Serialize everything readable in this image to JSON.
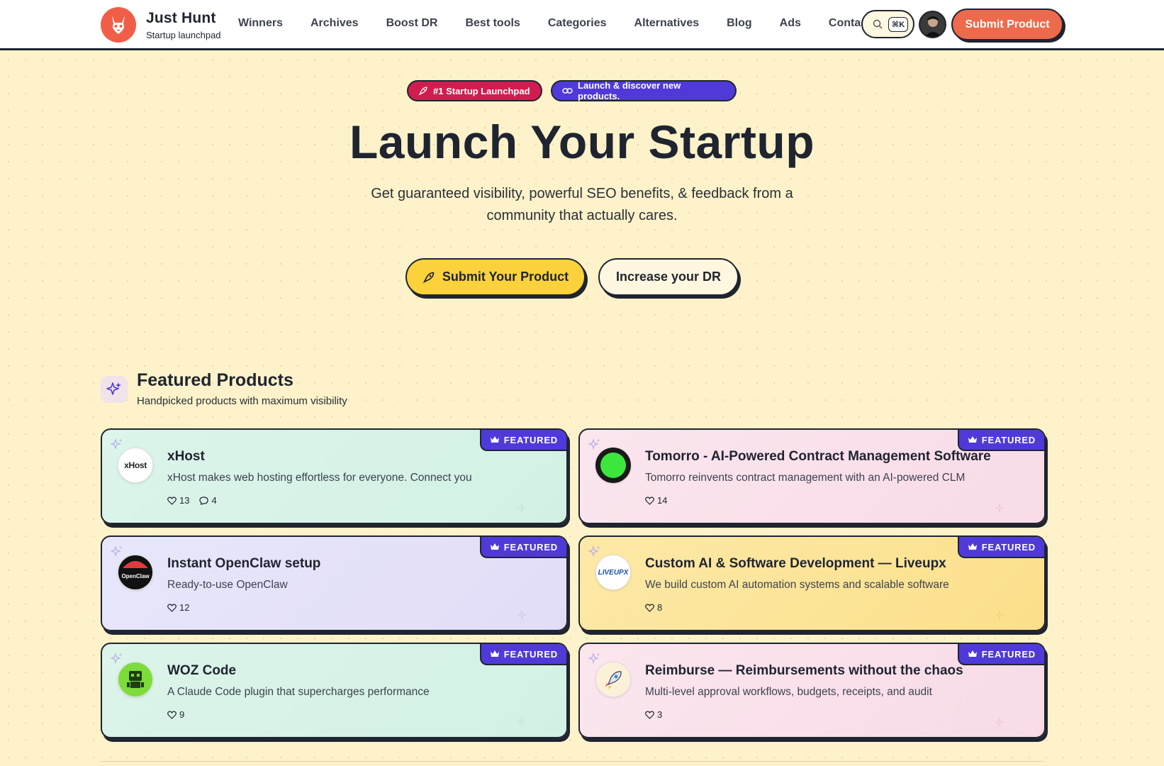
{
  "header": {
    "brand_name": "Just Hunt",
    "brand_sub": "Startup launchpad",
    "nav": [
      "Winners",
      "Archives",
      "Boost DR",
      "Best tools",
      "Categories",
      "Alternatives",
      "Blog",
      "Ads",
      "Contact"
    ],
    "search_kbd": "⌘K",
    "submit_label": "Submit  Product"
  },
  "hero": {
    "badge_1": "#1 Startup Launchpad",
    "badge_2": "Launch & discover new products.",
    "title": "Launch Your Startup",
    "subtitle_line_1": "Get guaranteed visibility, powerful SEO benefits, & feedback from a",
    "subtitle_line_2": "community that actually cares.",
    "primary_cta": "Submit Your Product",
    "secondary_cta": "Increase your DR"
  },
  "featured": {
    "title": "Featured Products",
    "subtitle": "Handpicked products with maximum visibility",
    "tag_label": "FEATURED",
    "products": [
      {
        "name": "xHost",
        "desc": "xHost makes web hosting effortless for everyone. Connect you",
        "likes": "13",
        "comments": "4",
        "logo_text": "xHost"
      },
      {
        "name": "Tomorro - AI-Powered Contract Management Software",
        "desc": "Tomorro reinvents contract management with an AI-powered CLM",
        "likes": "14"
      },
      {
        "name": "Instant OpenClaw setup",
        "desc": "Ready-to-use OpenClaw",
        "likes": "12",
        "logo_text": "OpenClaw"
      },
      {
        "name": "Custom AI & Software Development — Liveupx",
        "desc": "We build custom AI automation systems and scalable software",
        "likes": "8",
        "logo_text": "LIVEUPX"
      },
      {
        "name": "WOZ Code",
        "desc": "A Claude Code plugin that supercharges performance",
        "likes": "9"
      },
      {
        "name": "Reimburse — Reimbursements without the chaos",
        "desc": "Multi-level approval workflows, budgets, receipts, and audit",
        "likes": "3"
      }
    ]
  },
  "colors": {
    "page_bg": "#fdf2c9",
    "brand": "#f15e47",
    "accent_purple": "#4f3ad9",
    "badge_red": "#d11c4f",
    "cta_yellow": "#fbd13c"
  }
}
